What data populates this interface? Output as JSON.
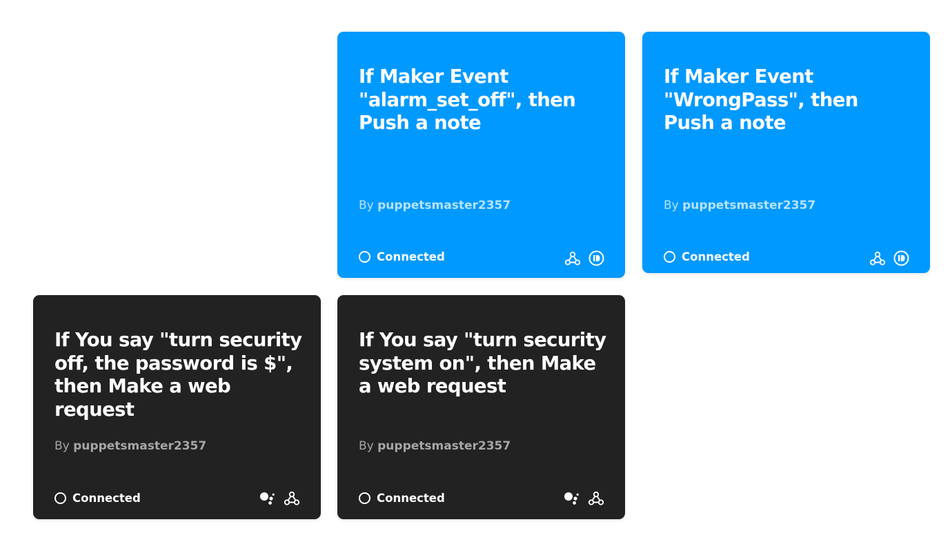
{
  "applets": [
    {
      "theme": "blue",
      "title": "If Maker Event \"alarm_set_off\", then Push a note",
      "by_prefix": "By",
      "author": "puppetsmaster2357",
      "status": "Connected",
      "service_icons": [
        "webhooks-icon",
        "pushbullet-icon"
      ],
      "background_color": "#0099ff"
    },
    {
      "theme": "blue",
      "title": "If Maker Event \"WrongPass\", then Push a note",
      "by_prefix": "By",
      "author": "puppetsmaster2357",
      "status": "Connected",
      "service_icons": [
        "webhooks-icon",
        "pushbullet-icon"
      ],
      "background_color": "#0099ff"
    },
    {
      "theme": "dark",
      "title": "If You say \"turn security off, the password is $\", then Make a web request",
      "by_prefix": "By",
      "author": "puppetsmaster2357",
      "status": "Connected",
      "service_icons": [
        "google-assistant-icon",
        "webhooks-icon"
      ],
      "background_color": "#222222"
    },
    {
      "theme": "dark",
      "title": "If You say \"turn security system on\", then Make a web request",
      "by_prefix": "By",
      "author": "puppetsmaster2357",
      "status": "Connected",
      "service_icons": [
        "google-assistant-icon",
        "webhooks-icon"
      ],
      "background_color": "#222222"
    }
  ]
}
